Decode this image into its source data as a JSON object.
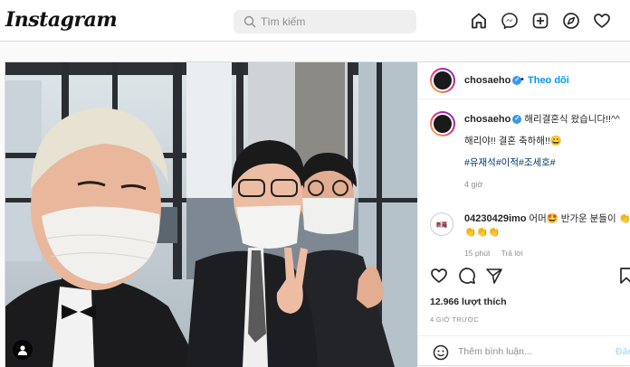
{
  "app": {
    "logo": "Instagram"
  },
  "search": {
    "placeholder": "Tìm kiếm"
  },
  "nav": {
    "icons": [
      "home-icon",
      "messenger-icon",
      "new-post-icon",
      "explore-icon",
      "heart-icon"
    ]
  },
  "post": {
    "author": "chosaeho",
    "follow_label": "Theo dõi",
    "separator": "•",
    "caption": {
      "line1": "해리결혼식 왔습니다!!^^",
      "line2": "해리야!! 결혼 축하해!!😀",
      "hashtags": "#유재석#이적#조세호#",
      "time": "4 giờ"
    },
    "comment": {
      "user": "04230429imo",
      "text": "어머🤩 반가운 분들이 👏👏👏👏",
      "time": "15 phút",
      "reply_label": "Trả lời",
      "avatar_text": "新羅"
    },
    "likes": "12.966 lượt thích",
    "posted": "4 GIỜ TRƯỚC",
    "add_comment_placeholder": "Thêm bình luận...",
    "post_button": "Đăng"
  },
  "colors": {
    "accent": "#0095f6",
    "verified": "#3897f0",
    "hashtag": "#00376b",
    "muted": "#8e8e8e"
  }
}
